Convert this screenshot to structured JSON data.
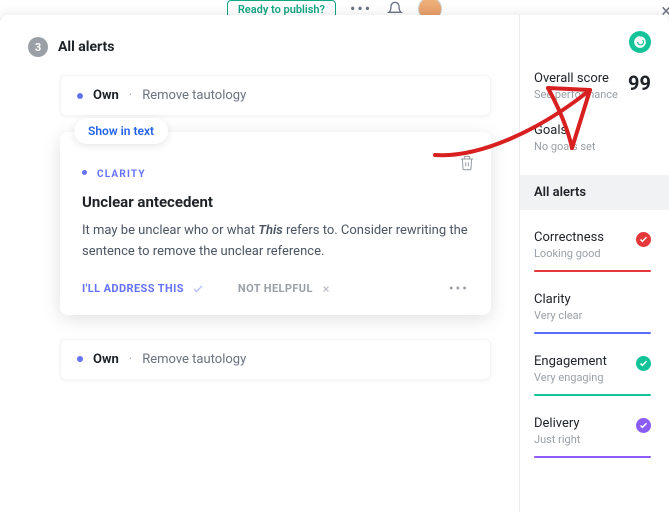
{
  "top": {
    "publish": "Ready to publish?"
  },
  "header": {
    "count": "3",
    "title": "All alerts"
  },
  "alerts": [
    {
      "word": "Own",
      "desc": "Remove tautology"
    },
    {
      "word": "Own",
      "desc": "Remove tautology"
    }
  ],
  "expanded": {
    "show_in_text": "Show in text",
    "category": "CLARITY",
    "title": "Unclear antecedent",
    "body_pre": "It may be unclear who or what ",
    "body_em": "This",
    "body_post": " refers to. Consider rewriting the sentence to remove the unclear reference.",
    "action_address": "I'LL ADDRESS THIS",
    "action_unhelpful": "NOT HELPFUL"
  },
  "sidebar": {
    "score_label": "Overall score",
    "score_value": "99",
    "score_sub": "See performance",
    "goals_title": "Goals",
    "goals_sub": "No goals set",
    "all_alerts": "All alerts",
    "metrics": [
      {
        "title": "Correctness",
        "sub": "Looking good",
        "color": "#e5383b",
        "check_bg": "#e5383b"
      },
      {
        "title": "Clarity",
        "sub": "Very clear",
        "color": "#5b6cff",
        "check_bg": ""
      },
      {
        "title": "Engagement",
        "sub": "Very engaging",
        "color": "#15c39a",
        "check_bg": "#15c39a"
      },
      {
        "title": "Delivery",
        "sub": "Just right",
        "color": "#8b5cf6",
        "check_bg": "#8b5cf6"
      }
    ]
  }
}
